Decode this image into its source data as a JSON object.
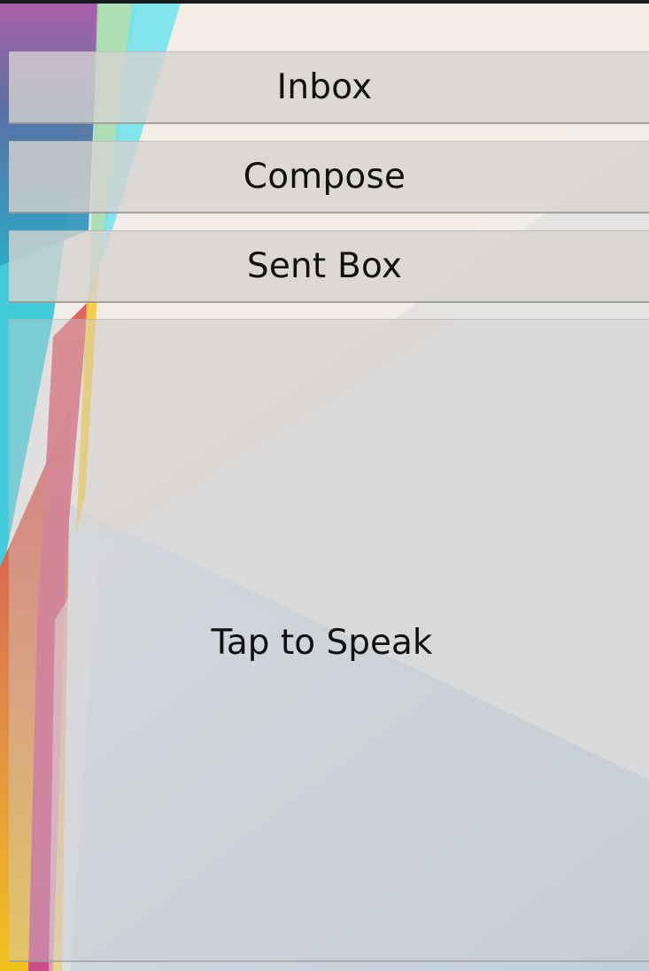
{
  "menu": {
    "inbox_label": "Inbox",
    "compose_label": "Compose",
    "sent_label": "Sent Box"
  },
  "speak": {
    "label": "Tap to Speak"
  },
  "theme": {
    "button_background": "#d6d2d0",
    "text_color": "#111111",
    "wallpaper_accents": [
      "#b35da8",
      "#43d6e6",
      "#e9584f",
      "#f2c01c",
      "#9fd8a8"
    ]
  }
}
